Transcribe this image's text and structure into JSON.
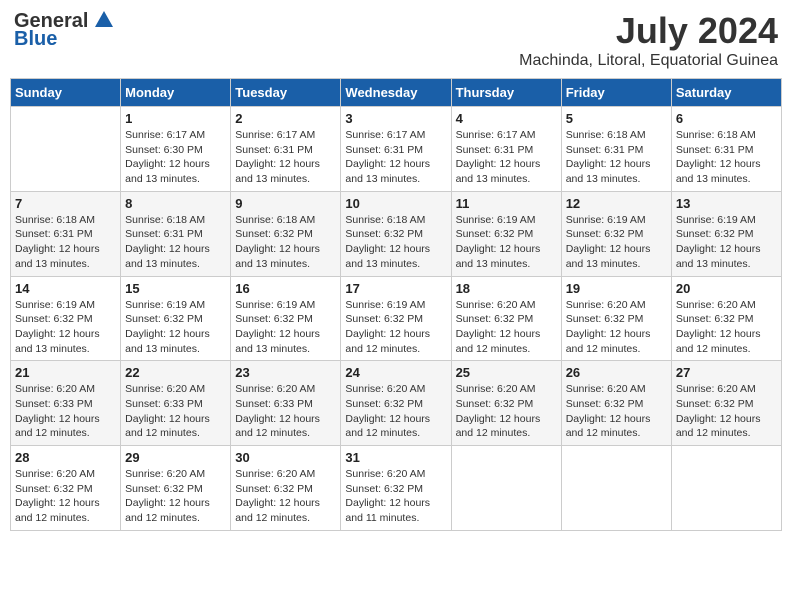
{
  "header": {
    "logo_general": "General",
    "logo_blue": "Blue",
    "month_title": "July 2024",
    "location": "Machinda, Litoral, Equatorial Guinea"
  },
  "weekdays": [
    "Sunday",
    "Monday",
    "Tuesday",
    "Wednesday",
    "Thursday",
    "Friday",
    "Saturday"
  ],
  "weeks": [
    [
      {
        "day": "",
        "sunrise": "",
        "sunset": "",
        "daylight": ""
      },
      {
        "day": "1",
        "sunrise": "Sunrise: 6:17 AM",
        "sunset": "Sunset: 6:30 PM",
        "daylight": "Daylight: 12 hours and 13 minutes."
      },
      {
        "day": "2",
        "sunrise": "Sunrise: 6:17 AM",
        "sunset": "Sunset: 6:31 PM",
        "daylight": "Daylight: 12 hours and 13 minutes."
      },
      {
        "day": "3",
        "sunrise": "Sunrise: 6:17 AM",
        "sunset": "Sunset: 6:31 PM",
        "daylight": "Daylight: 12 hours and 13 minutes."
      },
      {
        "day": "4",
        "sunrise": "Sunrise: 6:17 AM",
        "sunset": "Sunset: 6:31 PM",
        "daylight": "Daylight: 12 hours and 13 minutes."
      },
      {
        "day": "5",
        "sunrise": "Sunrise: 6:18 AM",
        "sunset": "Sunset: 6:31 PM",
        "daylight": "Daylight: 12 hours and 13 minutes."
      },
      {
        "day": "6",
        "sunrise": "Sunrise: 6:18 AM",
        "sunset": "Sunset: 6:31 PM",
        "daylight": "Daylight: 12 hours and 13 minutes."
      }
    ],
    [
      {
        "day": "7",
        "sunrise": "Sunrise: 6:18 AM",
        "sunset": "Sunset: 6:31 PM",
        "daylight": "Daylight: 12 hours and 13 minutes."
      },
      {
        "day": "8",
        "sunrise": "Sunrise: 6:18 AM",
        "sunset": "Sunset: 6:31 PM",
        "daylight": "Daylight: 12 hours and 13 minutes."
      },
      {
        "day": "9",
        "sunrise": "Sunrise: 6:18 AM",
        "sunset": "Sunset: 6:32 PM",
        "daylight": "Daylight: 12 hours and 13 minutes."
      },
      {
        "day": "10",
        "sunrise": "Sunrise: 6:18 AM",
        "sunset": "Sunset: 6:32 PM",
        "daylight": "Daylight: 12 hours and 13 minutes."
      },
      {
        "day": "11",
        "sunrise": "Sunrise: 6:19 AM",
        "sunset": "Sunset: 6:32 PM",
        "daylight": "Daylight: 12 hours and 13 minutes."
      },
      {
        "day": "12",
        "sunrise": "Sunrise: 6:19 AM",
        "sunset": "Sunset: 6:32 PM",
        "daylight": "Daylight: 12 hours and 13 minutes."
      },
      {
        "day": "13",
        "sunrise": "Sunrise: 6:19 AM",
        "sunset": "Sunset: 6:32 PM",
        "daylight": "Daylight: 12 hours and 13 minutes."
      }
    ],
    [
      {
        "day": "14",
        "sunrise": "Sunrise: 6:19 AM",
        "sunset": "Sunset: 6:32 PM",
        "daylight": "Daylight: 12 hours and 13 minutes."
      },
      {
        "day": "15",
        "sunrise": "Sunrise: 6:19 AM",
        "sunset": "Sunset: 6:32 PM",
        "daylight": "Daylight: 12 hours and 13 minutes."
      },
      {
        "day": "16",
        "sunrise": "Sunrise: 6:19 AM",
        "sunset": "Sunset: 6:32 PM",
        "daylight": "Daylight: 12 hours and 13 minutes."
      },
      {
        "day": "17",
        "sunrise": "Sunrise: 6:19 AM",
        "sunset": "Sunset: 6:32 PM",
        "daylight": "Daylight: 12 hours and 12 minutes."
      },
      {
        "day": "18",
        "sunrise": "Sunrise: 6:20 AM",
        "sunset": "Sunset: 6:32 PM",
        "daylight": "Daylight: 12 hours and 12 minutes."
      },
      {
        "day": "19",
        "sunrise": "Sunrise: 6:20 AM",
        "sunset": "Sunset: 6:32 PM",
        "daylight": "Daylight: 12 hours and 12 minutes."
      },
      {
        "day": "20",
        "sunrise": "Sunrise: 6:20 AM",
        "sunset": "Sunset: 6:32 PM",
        "daylight": "Daylight: 12 hours and 12 minutes."
      }
    ],
    [
      {
        "day": "21",
        "sunrise": "Sunrise: 6:20 AM",
        "sunset": "Sunset: 6:33 PM",
        "daylight": "Daylight: 12 hours and 12 minutes."
      },
      {
        "day": "22",
        "sunrise": "Sunrise: 6:20 AM",
        "sunset": "Sunset: 6:33 PM",
        "daylight": "Daylight: 12 hours and 12 minutes."
      },
      {
        "day": "23",
        "sunrise": "Sunrise: 6:20 AM",
        "sunset": "Sunset: 6:33 PM",
        "daylight": "Daylight: 12 hours and 12 minutes."
      },
      {
        "day": "24",
        "sunrise": "Sunrise: 6:20 AM",
        "sunset": "Sunset: 6:32 PM",
        "daylight": "Daylight: 12 hours and 12 minutes."
      },
      {
        "day": "25",
        "sunrise": "Sunrise: 6:20 AM",
        "sunset": "Sunset: 6:32 PM",
        "daylight": "Daylight: 12 hours and 12 minutes."
      },
      {
        "day": "26",
        "sunrise": "Sunrise: 6:20 AM",
        "sunset": "Sunset: 6:32 PM",
        "daylight": "Daylight: 12 hours and 12 minutes."
      },
      {
        "day": "27",
        "sunrise": "Sunrise: 6:20 AM",
        "sunset": "Sunset: 6:32 PM",
        "daylight": "Daylight: 12 hours and 12 minutes."
      }
    ],
    [
      {
        "day": "28",
        "sunrise": "Sunrise: 6:20 AM",
        "sunset": "Sunset: 6:32 PM",
        "daylight": "Daylight: 12 hours and 12 minutes."
      },
      {
        "day": "29",
        "sunrise": "Sunrise: 6:20 AM",
        "sunset": "Sunset: 6:32 PM",
        "daylight": "Daylight: 12 hours and 12 minutes."
      },
      {
        "day": "30",
        "sunrise": "Sunrise: 6:20 AM",
        "sunset": "Sunset: 6:32 PM",
        "daylight": "Daylight: 12 hours and 12 minutes."
      },
      {
        "day": "31",
        "sunrise": "Sunrise: 6:20 AM",
        "sunset": "Sunset: 6:32 PM",
        "daylight": "Daylight: 12 hours and 11 minutes."
      },
      {
        "day": "",
        "sunrise": "",
        "sunset": "",
        "daylight": ""
      },
      {
        "day": "",
        "sunrise": "",
        "sunset": "",
        "daylight": ""
      },
      {
        "day": "",
        "sunrise": "",
        "sunset": "",
        "daylight": ""
      }
    ]
  ]
}
